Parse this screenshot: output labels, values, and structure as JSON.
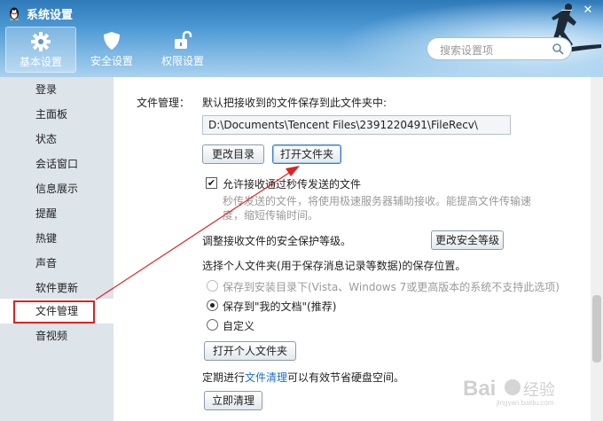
{
  "window": {
    "title": "系统设置",
    "min_label": "—",
    "close_label": "✕"
  },
  "tabs": [
    {
      "label": "基本设置",
      "icon": "gear-icon",
      "active": true
    },
    {
      "label": "安全设置",
      "icon": "shield-icon",
      "active": false
    },
    {
      "label": "权限设置",
      "icon": "lock-icon",
      "active": false
    }
  ],
  "search": {
    "placeholder": "搜索设置项"
  },
  "sidebar": {
    "items": [
      {
        "label": "登录"
      },
      {
        "label": "主面板"
      },
      {
        "label": "状态"
      },
      {
        "label": "会话窗口"
      },
      {
        "label": "信息展示"
      },
      {
        "label": "提醒"
      },
      {
        "label": "热键"
      },
      {
        "label": "声音"
      },
      {
        "label": "软件更新"
      },
      {
        "label": "文件管理"
      },
      {
        "label": "音视频"
      }
    ],
    "selected": "文件管理"
  },
  "file_mgmt": {
    "section_label": "文件管理：",
    "desc": "默认把接收到的文件保存到此文件夹中:",
    "path": "D:\\Documents\\Tencent Files\\2391220491\\FileRecv\\",
    "change_dir_btn": "更改目录",
    "open_folder_btn": "打开文件夹",
    "allow_transfer_label": "允许接收通过秒传发送的文件",
    "allow_transfer_checked": true,
    "note_line1": "秒传发送的文件，将使用极速服务器辅助接收。能提高文件传输速",
    "note_line2": "度，缩短传输时间。",
    "security_text": "调整接收文件的安全保护等级。",
    "security_btn": "更改安全等级",
    "personal_title": "选择个人文件夹(用于保存消息记录等数据)的保存位置。",
    "opt_install": "保存到安装目录下(Vista、Windows 7或更高版本的系统不支持此选项)",
    "opt_mydocs": "保存到\"我的文档\"(推荐)",
    "opt_custom": "自定义",
    "open_personal_btn": "打开个人文件夹",
    "cleanup_pre": "定期进行",
    "cleanup_link": "文件清理",
    "cleanup_post": "可以有效节省硬盘空间。",
    "cleanup_btn": "立即清理"
  },
  "colors": {
    "accent": "#3a7cc7",
    "highlight": "#e0211f",
    "link": "#1a6ecf"
  }
}
